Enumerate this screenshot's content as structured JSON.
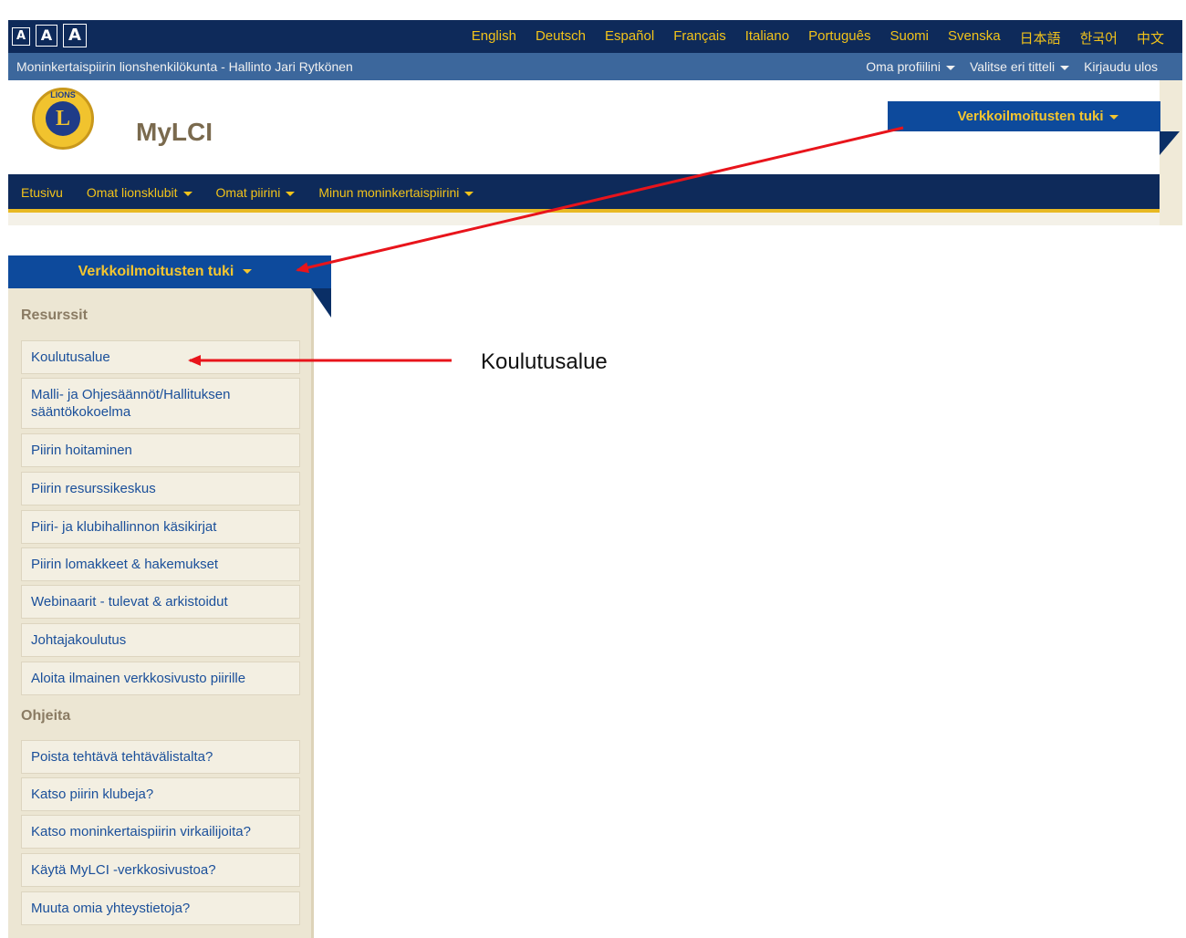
{
  "top": {
    "size_buttons": [
      "A",
      "A",
      "A"
    ],
    "languages": [
      "English",
      "Deutsch",
      "Español",
      "Français",
      "Italiano",
      "Português",
      "Suomi",
      "Svenska",
      "日本語",
      "한국어",
      "中文"
    ],
    "breadcrumb": "Moninkertaispiirin lionshenkilökunta - Hallinto Jari Rytkönen",
    "account_menu": {
      "profile": "Oma profiilini",
      "title_select": "Valitse eri titteli",
      "logout": "Kirjaudu ulos"
    },
    "logo_top_text": "LIONS",
    "logo_letter": "L",
    "brand": "MyLCI",
    "support_tab": "Verkkoilmoitusten tuki",
    "nav": {
      "home": "Etusivu",
      "my_clubs": "Omat lionsklubit",
      "my_districts": "Omat piirini",
      "my_multiple_district": "Minun moninkertaispiirini"
    }
  },
  "menu": {
    "support_tab": "Verkkoilmoitusten tuki",
    "resources_title": "Resurssit",
    "resources": [
      "Koulutusalue",
      "Malli- ja Ohjesäännöt/Hallituksen sääntökokoelma",
      "Piirin hoitaminen",
      "Piirin resurssikeskus",
      "Piiri- ja klubihallinnon käsikirjat",
      "Piirin lomakkeet & hakemukset",
      "Webinaarit - tulevat & arkistoidut",
      "Johtajakoulutus",
      "Aloita ilmainen verkkosivusto piirille"
    ],
    "howto_title": "Ohjeita",
    "howto": [
      "Poista tehtävä tehtävälistalta?",
      "Katso piirin klubeja?",
      "Katso moninkertaispiirin virkailijoita?",
      "Käytä MyLCI -verkkosivustoa?",
      "Muuta omia yhteystietoja?"
    ]
  },
  "annotation": {
    "label": "Koulutusalue",
    "arrow_color": "#e8141b"
  },
  "colors": {
    "navy": "#0e2a5a",
    "blue_bar": "#3c679c",
    "tab_blue": "#0d4a9c",
    "gold": "#f2c31a",
    "menu_bg": "#ece6d3",
    "link_blue": "#1a4f9a"
  }
}
